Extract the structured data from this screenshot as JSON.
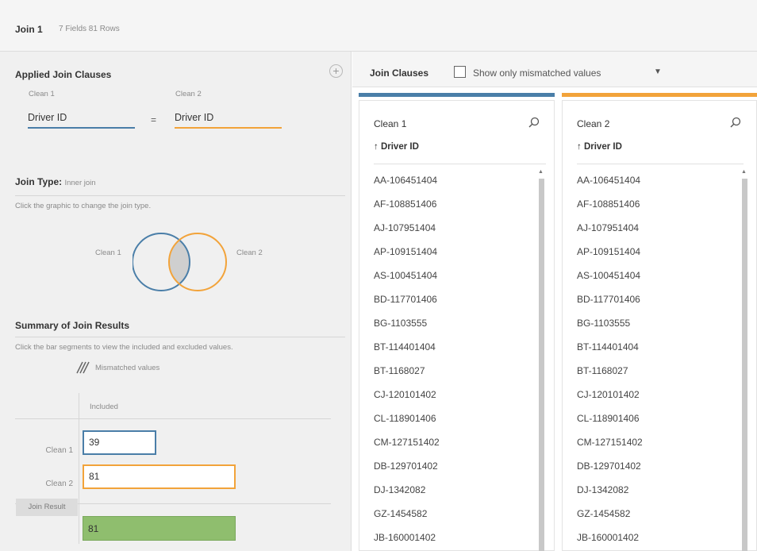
{
  "header": {
    "title": "Join 1",
    "meta": "7 Fields  81 Rows"
  },
  "left": {
    "applied_title": "Applied Join Clauses",
    "clause": {
      "left_label": "Clean 1",
      "right_label": "Clean 2",
      "left_field": "Driver ID",
      "operator": "=",
      "right_field": "Driver ID"
    },
    "join_type": {
      "title": "Join Type:",
      "value": "Inner join",
      "hint": "Click the graphic to change the join type.",
      "left_label": "Clean 1",
      "right_label": "Clean 2"
    },
    "summary": {
      "title": "Summary of Join Results",
      "hint": "Click the bar segments to view the included and excluded values.",
      "legend": "Mismatched values",
      "column_header": "Included",
      "rows": [
        {
          "label": "Clean 1",
          "value": "39"
        },
        {
          "label": "Clean 2",
          "value": "81"
        }
      ],
      "result_label": "Join Result",
      "result_value": "81"
    }
  },
  "right": {
    "title": "Join Clauses",
    "checkbox_label": "Show only mismatched values",
    "checkbox_checked": false,
    "columns": [
      {
        "name": "Clean 1",
        "field": "↑ Driver ID",
        "values": [
          "AA-106451404",
          "AF-108851406",
          "AJ-107951404",
          "AP-109151404",
          "AS-100451404",
          "BD-117701406",
          "BG-1103555",
          "BT-114401404",
          "BT-1168027",
          "CJ-120101402",
          "CL-118901406",
          "CM-127151402",
          "DB-129701402",
          "DJ-1342082",
          "GZ-1454582",
          "JB-160001402"
        ]
      },
      {
        "name": "Clean 2",
        "field": "↑ Driver ID",
        "values": [
          "AA-106451404",
          "AF-108851406",
          "AJ-107951404",
          "AP-109151404",
          "AS-100451404",
          "BD-117701406",
          "BG-1103555",
          "BT-114401404",
          "BT-1168027",
          "CJ-120101402",
          "CL-118901406",
          "CM-127151402",
          "DB-129701402",
          "DJ-1342082",
          "GZ-1454582",
          "JB-160001402"
        ]
      }
    ]
  },
  "colors": {
    "left_accent": "#4a7ea8",
    "right_accent": "#f2a33a",
    "result": "#8fbe6e"
  }
}
